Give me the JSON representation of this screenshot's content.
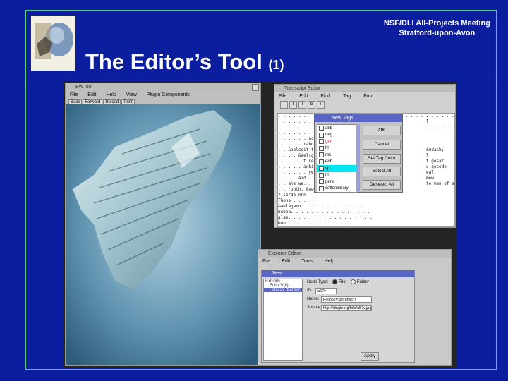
{
  "header": {
    "meeting_line1": "NSF/DLI All-Projects Meeting",
    "meeting_line2": "Stratford-upon-Avon",
    "title_main": "The Editor’s Tool",
    "title_suffix": "(1)"
  },
  "colors": {
    "background": "#0b1f9e",
    "rule": "#4dd17a",
    "text": "#ffffff"
  },
  "viewer_window": {
    "title": "BWTool",
    "menu": [
      "File",
      "Edit",
      "Help",
      "View",
      "Plugin Components"
    ],
    "toolbar": [
      "Back",
      "Forward",
      "Reload",
      "Print"
    ]
  },
  "transcript_window": {
    "title": "Transcript Editor",
    "menu": [
      "File",
      "Edit",
      "Find",
      "Tag",
      "Font"
    ],
    "toolbar": [
      "I",
      "T",
      "T",
      "b",
      "i"
    ],
    "lines": [
      ". . . . . . . . . . . . . . . . . . . . 7 rehte . . . . . .",
      ". . . . . . .",
      ". . . . . . . pld",
      ". . . . . . . . he",
      ". . . . . . ac e&",
      ". . . . . rabdacl",
      ". . &aelsgit te",
      ". . . . &aelsg",
      ". . . . . t rehte",
      ". . . . . awhit sy",
      ". . . . . . yere &cl",
      ". . . . ald . . .",
      ". . ahe we. . .",
      ". . robth, &aeli",
      "7 sorde hnn",
      "Thone . . . . .",
      "&aelagann. . . . . . . . . . . . .",
      "bebea. . . . . . . . . . . . . . . .",
      "glae. . . . . . . . . . . . . . . . .",
      "Don . . . . . . . . . . . . . ."
    ],
    "right_lines": [
      ". . . . . .",
      "l",
      ". . . . . . . .",
      "",
      "",
      "",
      "&mdash;",
      "l",
      "t gesat",
      "u gecede",
      "eal",
      "mew",
      "te men of seode"
    ]
  },
  "tags_dialog": {
    "title": "New Tags",
    "items": [
      "abb",
      "deg",
      "gen",
      "hl",
      "res",
      "enb",
      "sp",
      "nl",
      "pend",
      "cottonlibrary"
    ],
    "selected_index": 6,
    "buttons": [
      "OK",
      "Cancel",
      "Set Tag Color",
      "Select All",
      "Deselect All"
    ]
  },
  "explorer_window": {
    "title": "Explorer Editor",
    "menu": [
      "File",
      "Edit",
      "Tools",
      "Help"
    ],
    "tree": [
      "Exhibits",
      "Folio 3r(ii)",
      "Folio 3v (transcr)"
    ],
    "inner_title": "New",
    "node_type_label": "Node Type:",
    "radio_file": "File",
    "radio_folder": "Folder",
    "id_label": "ID:",
    "id_value": "a57v",
    "name_label": "Name:",
    "name_value": "Folio57v:3(transcr)",
    "source_label": "Source:",
    "source_value": "http://dingleorg/bifs/a57v.jpg",
    "apply_button": "Apply"
  }
}
